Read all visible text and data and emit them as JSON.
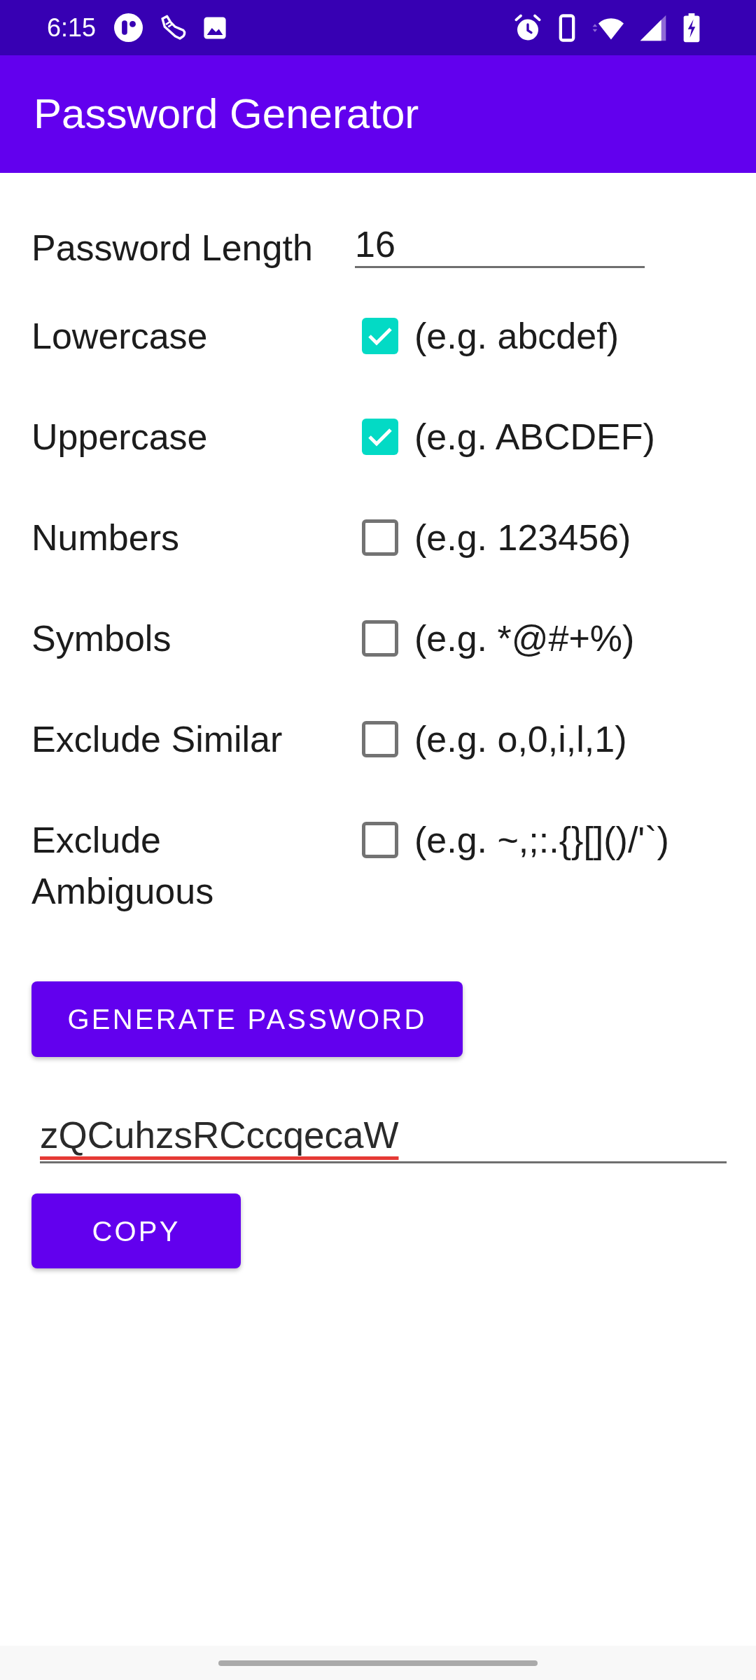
{
  "status_bar": {
    "time": "6:15"
  },
  "app_bar": {
    "title": "Password Generator"
  },
  "length_field": {
    "label": "Password Length",
    "value": "16"
  },
  "options": [
    {
      "label": "Lowercase",
      "example": "(e.g. abcdef)",
      "checked": true
    },
    {
      "label": "Uppercase",
      "example": "(e.g. ABCDEF)",
      "checked": true
    },
    {
      "label": "Numbers",
      "example": "(e.g. 123456)",
      "checked": false
    },
    {
      "label": "Symbols",
      "example": "(e.g. *@#+%)",
      "checked": false
    },
    {
      "label": "Exclude Similar",
      "example": "(e.g. o,0,i,l,1)",
      "checked": false
    },
    {
      "label": "Exclude Ambiguous",
      "example": "(e.g. ~,;:.{}[]()/'`)",
      "checked": false
    }
  ],
  "generate_button": {
    "label": "GENERATE PASSWORD"
  },
  "result_field": {
    "value": "zQCuhzsRCccqecaW",
    "misspelled": true
  },
  "copy_button": {
    "label": "COPY"
  }
}
